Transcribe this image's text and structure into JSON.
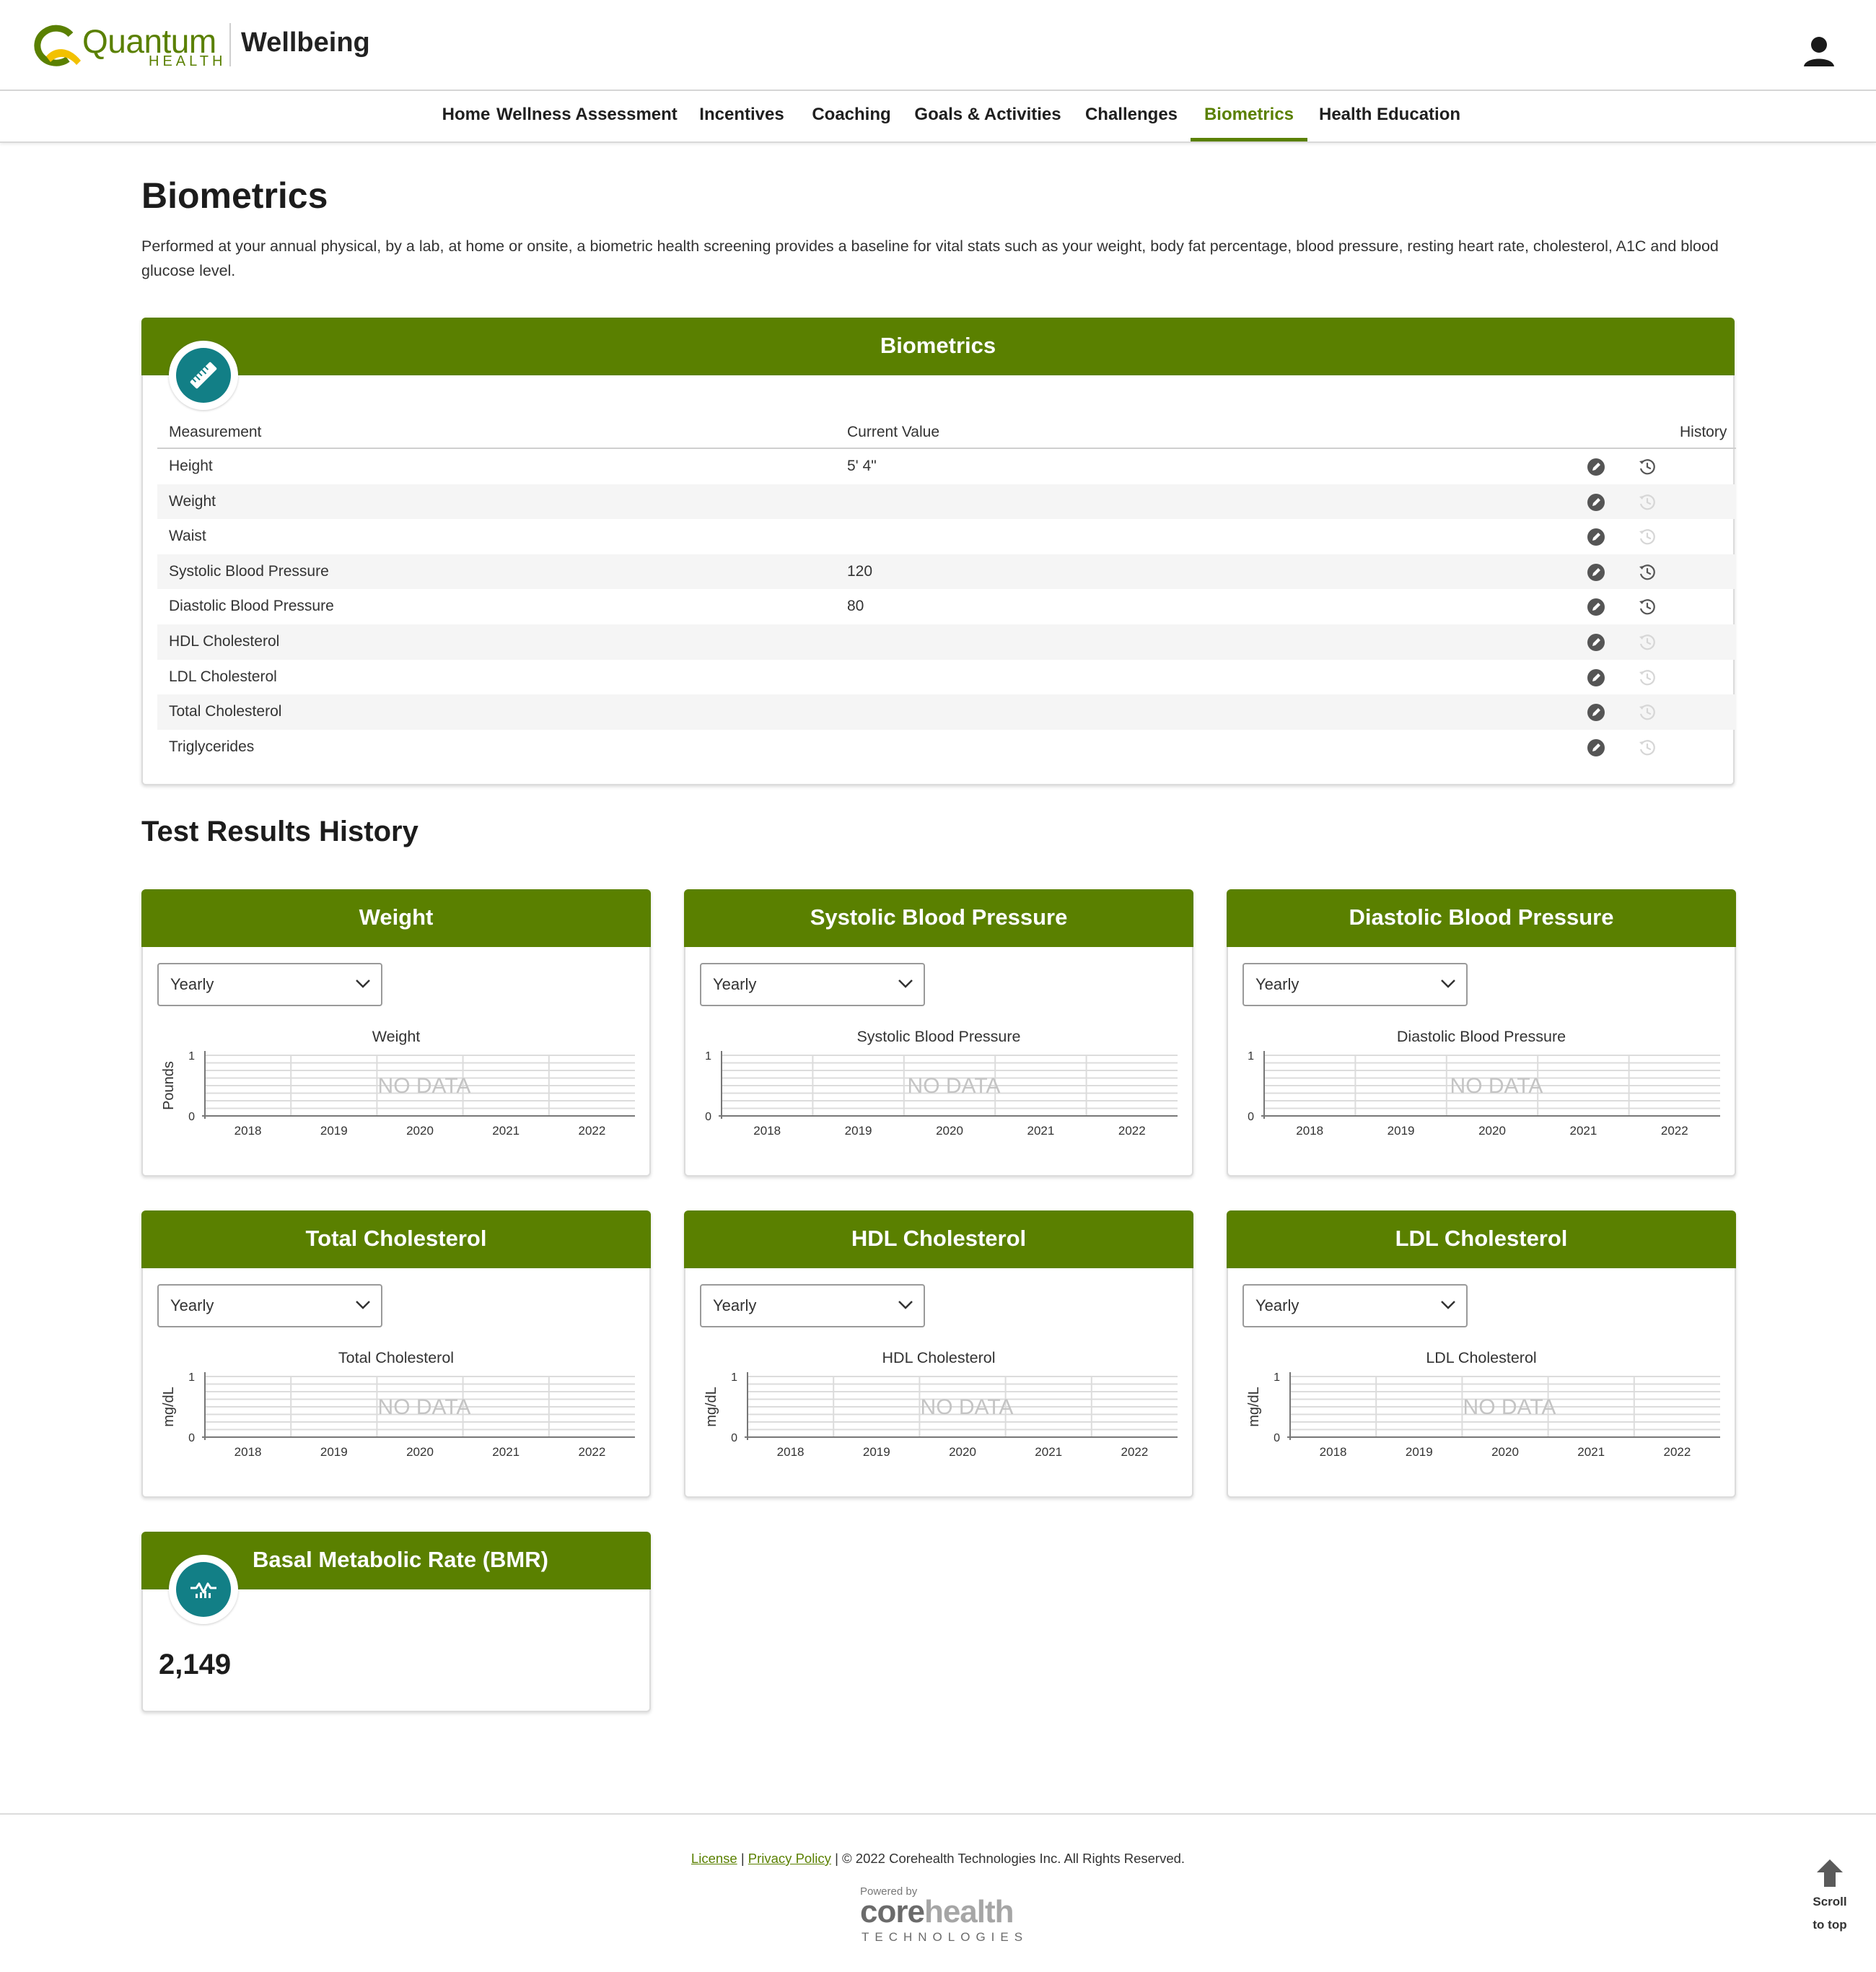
{
  "header": {
    "logo_word": "Quantum",
    "logo_sub": "HEALTH",
    "app_title": "Wellbeing",
    "logo_color": "#5a8000",
    "logo_accent": "#f2c100"
  },
  "nav": {
    "items": [
      {
        "label": "Home"
      },
      {
        "label": "Wellness Assessment"
      },
      {
        "label": "Incentives"
      },
      {
        "label": "Coaching"
      },
      {
        "label": "Goals & Activities"
      },
      {
        "label": "Challenges"
      },
      {
        "label": "Biometrics",
        "active": true
      },
      {
        "label": "Health Education"
      }
    ]
  },
  "page": {
    "title": "Biometrics",
    "intro": "Performed at your annual physical, by a lab, at home or onsite, a biometric health screening provides a baseline for vital stats such as your weight, body fat percentage, blood pressure, resting heart rate, cholesterol, A1C and blood glucose level.",
    "history_title": "Test Results History"
  },
  "biometrics": {
    "title": "Biometrics",
    "icon": "ruler-icon",
    "columns": {
      "measurement": "Measurement",
      "current": "Current Value",
      "history": "History"
    },
    "rows": [
      {
        "name": "Height",
        "value": "5' 4\"",
        "has_history": true
      },
      {
        "name": "Weight",
        "value": "",
        "has_history": false
      },
      {
        "name": "Waist",
        "value": "",
        "has_history": false
      },
      {
        "name": "Systolic Blood Pressure",
        "value": "120",
        "has_history": true
      },
      {
        "name": "Diastolic Blood Pressure",
        "value": "80",
        "has_history": true
      },
      {
        "name": "HDL Cholesterol",
        "value": "",
        "has_history": false
      },
      {
        "name": "LDL Cholesterol",
        "value": "",
        "has_history": false
      },
      {
        "name": "Total Cholesterol",
        "value": "",
        "has_history": false
      },
      {
        "name": "Triglycerides",
        "value": "",
        "has_history": false
      }
    ]
  },
  "charts": [
    {
      "card_title": "Weight",
      "period": "Yearly",
      "chart_title": "Weight",
      "ylabel": "Pounds",
      "no_data": "NO DATA"
    },
    {
      "card_title": "Systolic Blood Pressure",
      "period": "Yearly",
      "chart_title": "Systolic Blood Pressure",
      "ylabel": "",
      "no_data": "NO DATA"
    },
    {
      "card_title": "Diastolic Blood Pressure",
      "period": "Yearly",
      "chart_title": "Diastolic Blood Pressure",
      "ylabel": "",
      "no_data": "NO DATA"
    },
    {
      "card_title": "Total Cholesterol",
      "period": "Yearly",
      "chart_title": "Total Cholesterol",
      "ylabel": "mg/dL",
      "no_data": "NO DATA"
    },
    {
      "card_title": "HDL Cholesterol",
      "period": "Yearly",
      "chart_title": "HDL Cholesterol",
      "ylabel": "mg/dL",
      "no_data": "NO DATA"
    },
    {
      "card_title": "LDL Cholesterol",
      "period": "Yearly",
      "chart_title": "LDL Cholesterol",
      "ylabel": "mg/dL",
      "no_data": "NO DATA"
    }
  ],
  "chart_data": [
    {
      "type": "line",
      "title": "Weight",
      "ylabel": "Pounds",
      "x": [
        "2018",
        "2019",
        "2020",
        "2021",
        "2022"
      ],
      "ylim": [
        0,
        1
      ],
      "yticks": [
        "0",
        "1"
      ],
      "series": [],
      "grid": true
    },
    {
      "type": "line",
      "title": "Systolic Blood Pressure",
      "ylabel": "",
      "x": [
        "2018",
        "2019",
        "2020",
        "2021",
        "2022"
      ],
      "ylim": [
        0,
        1
      ],
      "yticks": [
        "0",
        "1"
      ],
      "series": [],
      "grid": true
    },
    {
      "type": "line",
      "title": "Diastolic Blood Pressure",
      "ylabel": "",
      "x": [
        "2018",
        "2019",
        "2020",
        "2021",
        "2022"
      ],
      "ylim": [
        0,
        1
      ],
      "yticks": [
        "0",
        "1"
      ],
      "series": [],
      "grid": true
    },
    {
      "type": "line",
      "title": "Total Cholesterol",
      "ylabel": "mg/dL",
      "x": [
        "2018",
        "2019",
        "2020",
        "2021",
        "2022"
      ],
      "ylim": [
        0,
        1
      ],
      "yticks": [
        "0",
        "1"
      ],
      "series": [],
      "grid": true
    },
    {
      "type": "line",
      "title": "HDL Cholesterol",
      "ylabel": "mg/dL",
      "x": [
        "2018",
        "2019",
        "2020",
        "2021",
        "2022"
      ],
      "ylim": [
        0,
        1
      ],
      "yticks": [
        "0",
        "1"
      ],
      "series": [],
      "grid": true
    },
    {
      "type": "line",
      "title": "LDL Cholesterol",
      "ylabel": "mg/dL",
      "x": [
        "2018",
        "2019",
        "2020",
        "2021",
        "2022"
      ],
      "ylim": [
        0,
        1
      ],
      "yticks": [
        "0",
        "1"
      ],
      "series": [],
      "grid": true
    }
  ],
  "bmr": {
    "title": "Basal Metabolic Rate (BMR)",
    "value": "2,149",
    "icon": "heart-rate-chart-icon"
  },
  "footer": {
    "license": "License",
    "separator": "|",
    "privacy": "Privacy Policy",
    "copyright": "© 2022 Corehealth Technologies Inc. All Rights Reserved.",
    "powered_by": "Powered by",
    "brand_core": "core",
    "brand_health": "health",
    "brand_tech": "TECHNOLOGIES",
    "scroll_line1": "Scroll",
    "scroll_line2": "to top"
  },
  "colors": {
    "brand_green": "#5a8000",
    "teal": "#127f86",
    "grid": "#dcdcdc"
  }
}
